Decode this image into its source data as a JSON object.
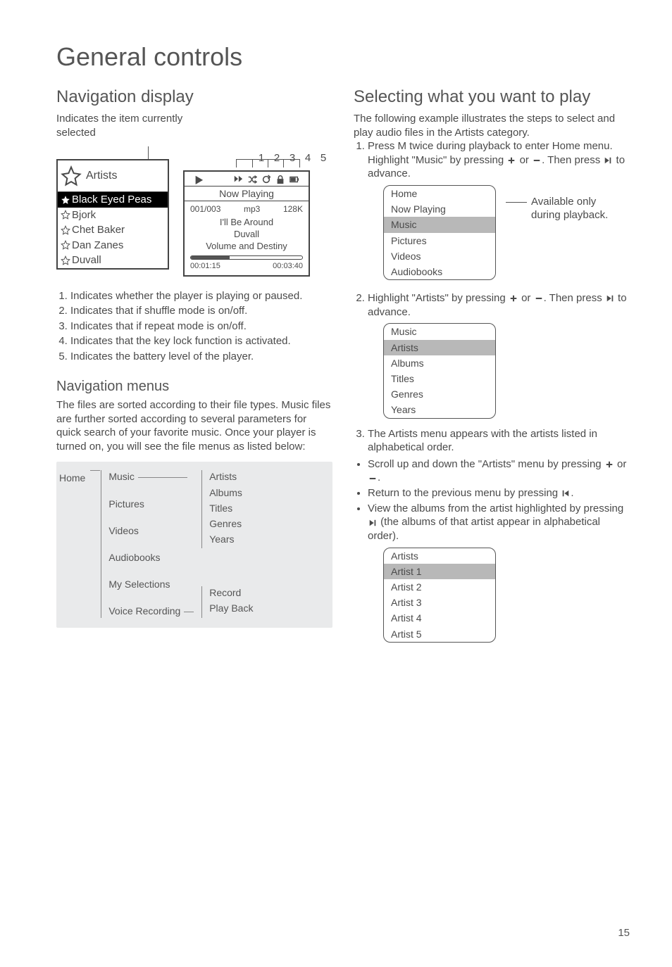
{
  "page": {
    "title": "General controls",
    "number": "15"
  },
  "left": {
    "nav_display_heading": "Navigation display",
    "nav_display_sub": "Indicates the item currently selected",
    "callouts": [
      "1",
      "2",
      "3",
      "4",
      "5"
    ],
    "panel1": {
      "header": "Artists",
      "items": [
        "Black Eyed Peas",
        "Bjork",
        "Chet Baker",
        "Dan Zanes",
        "Duvall"
      ]
    },
    "panel2": {
      "now_playing": "Now Playing",
      "track_pos": "001/003",
      "format": "mp3",
      "bitrate": "128K",
      "song": "I'll Be Around",
      "artist": "Duvall",
      "album": "Volume and Destiny",
      "t_elapsed": "00:01:15",
      "t_total": "00:03:40"
    },
    "legend": [
      "Indicates whether the player is playing or paused.",
      "Indicates that if shuffle mode is on/off.",
      "Indicates that if repeat mode is on/off.",
      "Indicates that the key lock function is activated.",
      "Indicates the battery level of the player."
    ],
    "nav_menus_heading": "Navigation menus",
    "nav_menus_para": "The files are sorted according to their file types. Music files are further sorted according to several parameters for quick search of your favorite music. Once your player is turned on, you will see the file menus as listed below:",
    "tree": {
      "root": "Home",
      "l1": [
        "Music",
        "Pictures",
        "Videos",
        "Audiobooks",
        "My Selections",
        "Voice Recording"
      ],
      "music_children": [
        "Artists",
        "Albums",
        "Titles",
        "Genres",
        "Years"
      ],
      "vr_children": [
        "Record",
        "Play Back"
      ]
    }
  },
  "right": {
    "heading": "Selecting what you want to play",
    "intro": "The following example illustrates the steps to select and play audio files in the Artists category.",
    "step1a": "Press M twice during playback to enter Home menu. Highlight \"Music\" by pressing ",
    "step1b": " or ",
    "step1c": ". Then press ",
    "step1d": " to advance.",
    "menu1": {
      "header": "Home",
      "items": [
        "Now Playing",
        "Music",
        "Pictures",
        "Videos",
        "Audiobooks"
      ],
      "selected_index": 1
    },
    "side_note_a": "Available only",
    "side_note_b": "during playback.",
    "step2a": "Highlight \"Artists\" by pressing ",
    "step2b": " or ",
    "step2c": ". Then press ",
    "step2d": " to advance.",
    "menu2": {
      "header": "Music",
      "items": [
        "Artists",
        "Albums",
        "Titles",
        "Genres",
        "Years"
      ],
      "selected_index": 0
    },
    "step3": "The Artists menu appears with the artists listed in alphabetical order.",
    "b1a": "Scroll up and down the \"Artists\" menu by pressing ",
    "b1b": " or ",
    "b1c": ".",
    "b2a": "Return to the previous menu by pressing ",
    "b2b": ".",
    "b3a": "View the albums from the artist highlighted by pressing ",
    "b3b": " (the albums of that artist appear in alphabetical order).",
    "menu3": {
      "header": "Artists",
      "items": [
        "Artist 1",
        "Artist 2",
        "Artist 3",
        "Artist 4",
        "Artist 5"
      ],
      "selected_index": 0
    }
  }
}
